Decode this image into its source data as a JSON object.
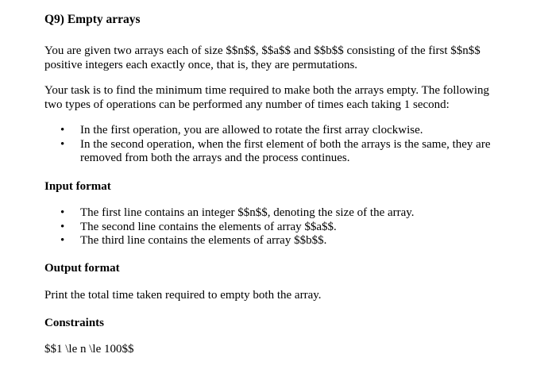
{
  "title": "Q9) Empty arrays",
  "intro": {
    "line1": "You are given two arrays each of size $$n$$, $$a$$ and $$b$$ consisting of the first $$n$$",
    "line2": "positive integers each exactly once, that is, they are permutations."
  },
  "task": {
    "line1": "Your task is to find the minimum time required to make both the arrays empty. The following",
    "line2": "two types of operations can be performed any number of times each taking 1 second:"
  },
  "operations": [
    {
      "lines": [
        "In the first operation, you are allowed to rotate the first array clockwise."
      ]
    },
    {
      "lines": [
        "In the second operation, when the first element of both the arrays is the same, they are",
        "removed from both the arrays and the process continues."
      ]
    }
  ],
  "input_format": {
    "heading": "Input format",
    "items": [
      "The first line contains an integer $$n$$, denoting the size of the array.",
      "The second line contains the elements of array $$a$$.",
      "The third line contains the elements of array $$b$$."
    ]
  },
  "output_format": {
    "heading": "Output format",
    "text": "Print the total time taken required to empty both the array."
  },
  "constraints": {
    "heading": "Constraints",
    "text": "$$1 \\le n \\le 100$$"
  },
  "bullet_glyph": "•"
}
